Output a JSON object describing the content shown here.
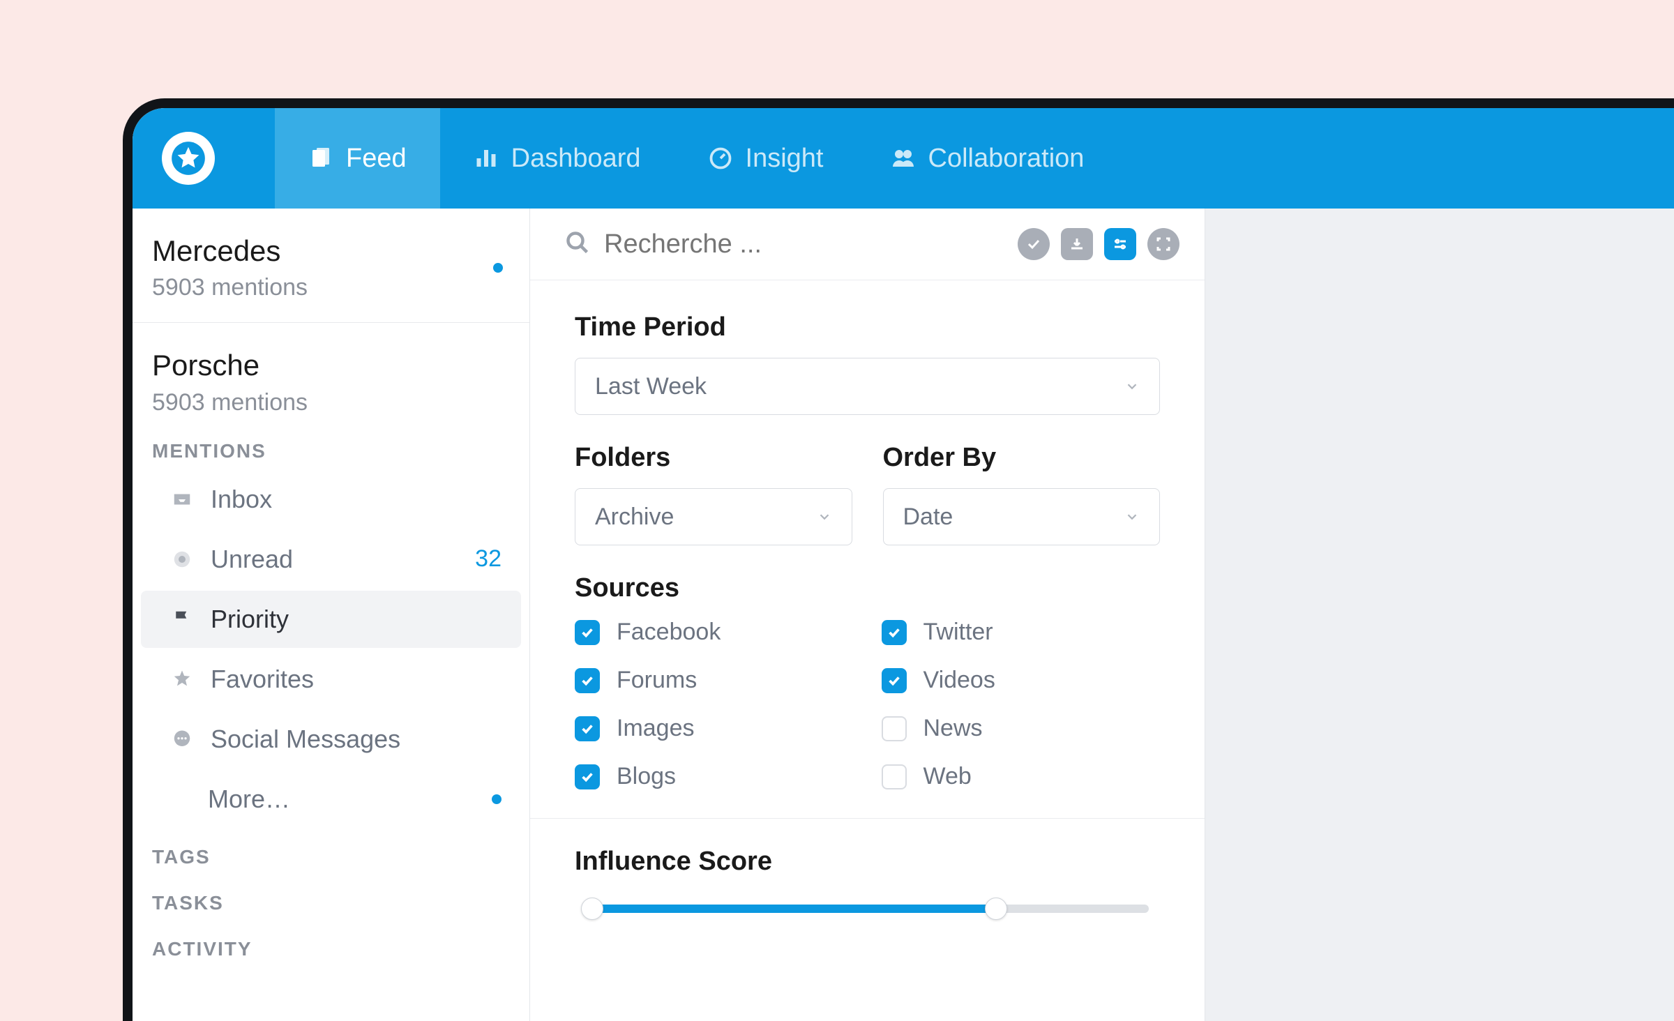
{
  "nav": {
    "tabs": [
      {
        "id": "feed",
        "label": "Feed",
        "active": true
      },
      {
        "id": "dashboard",
        "label": "Dashboard",
        "active": false
      },
      {
        "id": "insight",
        "label": "Insight",
        "active": false
      },
      {
        "id": "collaboration",
        "label": "Collaboration",
        "active": false
      }
    ]
  },
  "sidebar": {
    "alerts": [
      {
        "name": "Mercedes",
        "mentions_text": "5903 mentions",
        "has_dot": true
      },
      {
        "name": "Porsche",
        "mentions_text": "5903 mentions",
        "has_dot": false
      }
    ],
    "mentions_header": "MENTIONS",
    "menu": {
      "inbox": "Inbox",
      "unread": "Unread",
      "unread_count": "32",
      "priority": "Priority",
      "favorites": "Favorites",
      "social": "Social Messages",
      "more": "More…"
    },
    "sections": {
      "tags": "TAGS",
      "tasks": "TASKS",
      "activity": "ACTIVITY"
    }
  },
  "search": {
    "placeholder": "Recherche ..."
  },
  "filters": {
    "time_period": {
      "label": "Time Period",
      "value": "Last Week"
    },
    "folders": {
      "label": "Folders",
      "value": "Archive"
    },
    "order_by": {
      "label": "Order By",
      "value": "Date"
    },
    "sources": {
      "label": "Sources",
      "items": [
        {
          "label": "Facebook",
          "checked": true
        },
        {
          "label": "Twitter",
          "checked": true
        },
        {
          "label": "Forums",
          "checked": true
        },
        {
          "label": "Videos",
          "checked": true
        },
        {
          "label": "Images",
          "checked": true
        },
        {
          "label": "News",
          "checked": false
        },
        {
          "label": "Blogs",
          "checked": true
        },
        {
          "label": "Web",
          "checked": false
        }
      ]
    },
    "influence": {
      "label": "Influence Score",
      "min_pct": 3,
      "max_pct": 72
    }
  }
}
